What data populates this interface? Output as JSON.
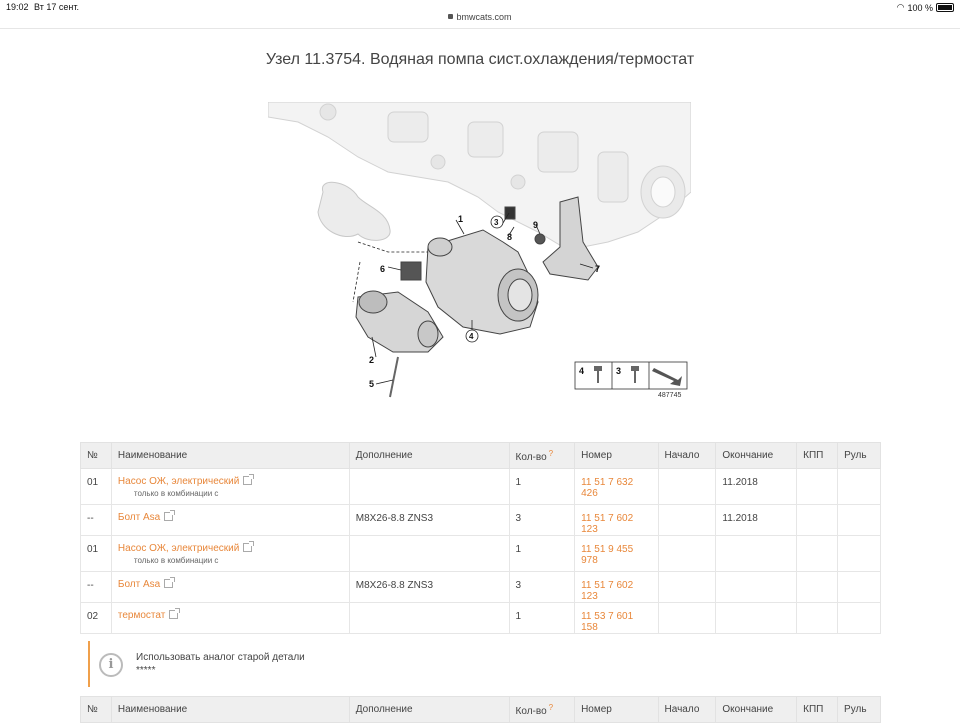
{
  "status": {
    "time": "19:02",
    "date": "Вт 17 сент.",
    "battery": "100 %"
  },
  "browser": {
    "url": "bmwcats.com"
  },
  "page": {
    "title": "Узел 11.3754. Водяная помпа сист.охлаждения/термостат"
  },
  "diagram": {
    "callouts": [
      "1",
      "2",
      "3",
      "4",
      "5",
      "6",
      "7",
      "8",
      "9"
    ],
    "legend": [
      "4",
      "3"
    ],
    "image_id": "487745"
  },
  "table": {
    "headers": [
      "№",
      "Наименование",
      "Дополнение",
      "Кол-во",
      "Номер",
      "Начало",
      "Окончание",
      "КПП",
      "Руль"
    ],
    "qty_hint": "?",
    "rows": [
      {
        "no": "01",
        "name": "Насос ОЖ, электрический",
        "sub": "только в комбинации с",
        "extra": "",
        "qty": "1",
        "number": "11 51 7 632 426",
        "start": "",
        "end": "11.2018"
      },
      {
        "no": "--",
        "name": "Болт Asa",
        "sub": "",
        "extra": "M8X26-8.8 ZNS3",
        "qty": "3",
        "number": "11 51 7 602 123",
        "start": "",
        "end": "11.2018"
      },
      {
        "no": "01",
        "name": "Насос ОЖ, электрический",
        "sub": "только в комбинации с",
        "extra": "",
        "qty": "1",
        "number": "11 51 9 455 978",
        "start": "",
        "end": ""
      },
      {
        "no": "--",
        "name": "Болт Asa",
        "sub": "",
        "extra": "M8X26-8.8 ZNS3",
        "qty": "3",
        "number": "11 51 7 602 123",
        "start": "",
        "end": ""
      },
      {
        "no": "02",
        "name": "термостат",
        "sub": "",
        "extra": "",
        "qty": "1",
        "number": "11 53 7 601 158",
        "start": "",
        "end": ""
      }
    ]
  },
  "notice": {
    "text": "Использовать аналог старой детали",
    "stars": "*****"
  }
}
